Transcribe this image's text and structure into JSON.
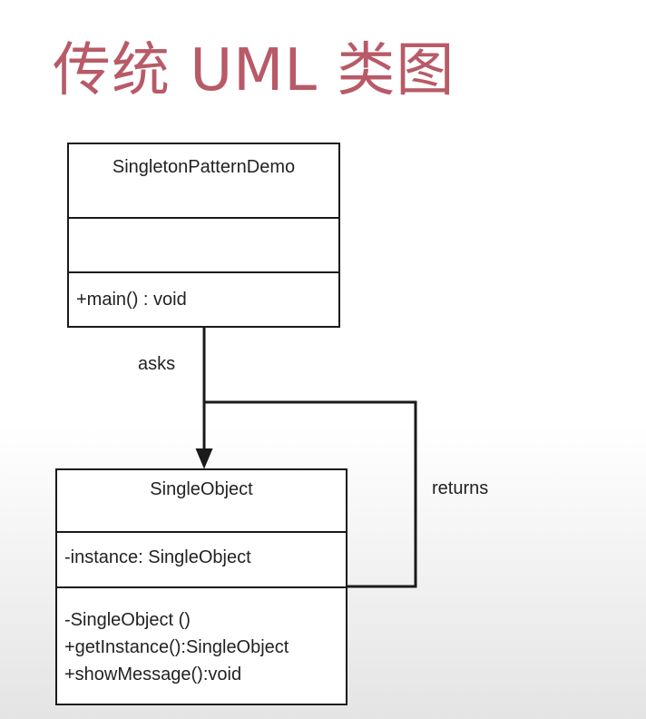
{
  "title": "传统 UML 类图",
  "classes": {
    "demo": {
      "name": "SingletonPatternDemo",
      "attributes": [],
      "methods": [
        "+main() : void"
      ]
    },
    "single_object": {
      "name": "SingleObject",
      "attributes": [
        "-instance: SingleObject"
      ],
      "methods": [
        "-SingleObject ()",
        "+getInstance():SingleObject",
        "+showMessage():void"
      ]
    }
  },
  "relations": {
    "asks": "asks",
    "returns": "returns"
  },
  "colors": {
    "title": "#b85a67",
    "line": "#1a1a1a"
  }
}
